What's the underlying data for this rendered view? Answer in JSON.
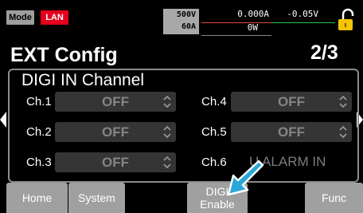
{
  "status": {
    "mode": "Mode",
    "interface": "LAN",
    "voltage_range": "500V",
    "current_range": "60A",
    "current_reading": "0.000A",
    "voltage_reading": "-0.05V",
    "power_reading": "0W"
  },
  "header": {
    "title": "EXT Config",
    "page": "2/3"
  },
  "panel": {
    "title": "DIGI IN Channel",
    "channels": [
      {
        "label": "Ch.1",
        "value": "OFF"
      },
      {
        "label": "Ch.2",
        "value": "OFF"
      },
      {
        "label": "Ch.3",
        "value": "OFF"
      },
      {
        "label": "Ch.4",
        "value": "OFF"
      },
      {
        "label": "Ch.5",
        "value": "OFF"
      },
      {
        "label": "Ch.6",
        "value": "U ALARM IN"
      }
    ]
  },
  "footer": {
    "home": "Home",
    "system": "System",
    "digi_line1": "DIGI",
    "digi_line2": "Enable",
    "func": "Func"
  },
  "colors": {
    "accent_red": "#e5001c",
    "lock_yellow": "#f5c400",
    "pointer_blue": "#2aa6d8"
  }
}
